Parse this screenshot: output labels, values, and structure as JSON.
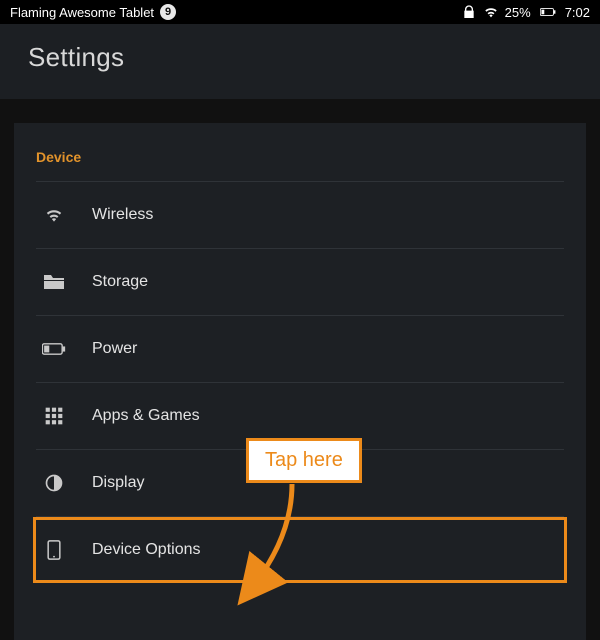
{
  "status_bar": {
    "device_name": "Flaming Awesome Tablet",
    "notification_count": "9",
    "battery_percent": "25%",
    "clock": "7:02"
  },
  "header": {
    "title": "Settings"
  },
  "section": {
    "title": "Device",
    "items": [
      {
        "icon": "wifi-icon",
        "name": "settings-wireless",
        "label": "Wireless"
      },
      {
        "icon": "folder-icon",
        "name": "settings-storage",
        "label": "Storage"
      },
      {
        "icon": "battery-icon",
        "name": "settings-power",
        "label": "Power"
      },
      {
        "icon": "grid-icon",
        "name": "settings-apps-games",
        "label": "Apps & Games"
      },
      {
        "icon": "contrast-icon",
        "name": "settings-display",
        "label": "Display"
      },
      {
        "icon": "tablet-icon",
        "name": "settings-device-options",
        "label": "Device Options",
        "highlighted": true
      }
    ]
  },
  "callout": {
    "text": "Tap here"
  },
  "colors": {
    "accent": "#ec8a1a"
  }
}
